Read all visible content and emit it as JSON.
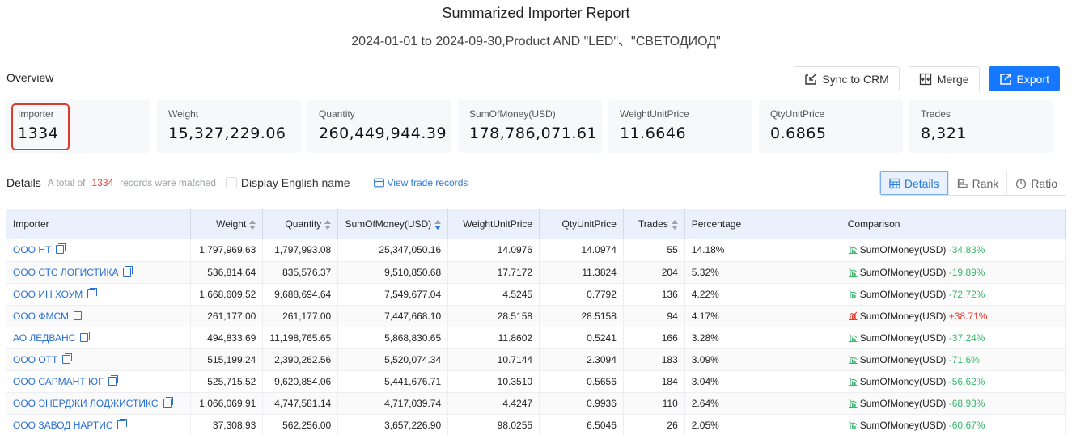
{
  "report": {
    "title": "Summarized Importer Report",
    "subtitle": "2024-01-01 to 2024-09-30,Product AND \"LED\"、\"СВЕТОДИОД\""
  },
  "overview": {
    "label": "Overview",
    "actions": {
      "sync_crm": "Sync to CRM",
      "merge": "Merge",
      "export": "Export"
    },
    "stats": [
      {
        "label": "Importer",
        "value": "1334"
      },
      {
        "label": "Weight",
        "value": "15,327,229.06"
      },
      {
        "label": "Quantity",
        "value": "260,449,944.39"
      },
      {
        "label": "SumOfMoney(USD)",
        "value": "178,786,071.61"
      },
      {
        "label": "WeightUnitPrice",
        "value": "11.6646"
      },
      {
        "label": "QtyUnitPrice",
        "value": "0.6865"
      },
      {
        "label": "Trades",
        "value": "8,321"
      }
    ]
  },
  "details": {
    "title": "Details",
    "total_prefix": "A total of",
    "total_count": "1334",
    "total_suffix": "records were matched",
    "display_english": "Display English name",
    "display_english_checked": false,
    "view_trade_records": "View trade records",
    "views": {
      "details": "Details",
      "rank": "Rank",
      "ratio": "Ratio",
      "active": "details"
    }
  },
  "table": {
    "columns": {
      "importer": "Importer",
      "weight": "Weight",
      "quantity": "Quantity",
      "sum": "SumOfMoney(USD)",
      "wup": "WeightUnitPrice",
      "qup": "QtyUnitPrice",
      "trades": "Trades",
      "percentage": "Percentage",
      "comparison": "Comparison"
    },
    "rows": [
      {
        "importer": "ООО НТ",
        "weight": "1,797,969.63",
        "quantity": "1,797,993.08",
        "sum": "25,347,050.16",
        "wup": "14.0976",
        "qup": "14.0974",
        "trades": "55",
        "percentage": "14.18%",
        "cmp_label": "SumOfMoney(USD)",
        "cmp_value": "-34.83%",
        "cmp_dir": "down"
      },
      {
        "importer": "ООО СТС ЛОГИСТИКА",
        "weight": "536,814.64",
        "quantity": "835,576.37",
        "sum": "9,510,850.68",
        "wup": "17.7172",
        "qup": "11.3824",
        "trades": "204",
        "percentage": "5.32%",
        "cmp_label": "SumOfMoney(USD)",
        "cmp_value": "-19.89%",
        "cmp_dir": "down"
      },
      {
        "importer": "ООО ИН ХОУМ",
        "weight": "1,668,609.52",
        "quantity": "9,688,694.64",
        "sum": "7,549,677.04",
        "wup": "4.5245",
        "qup": "0.7792",
        "trades": "136",
        "percentage": "4.22%",
        "cmp_label": "SumOfMoney(USD)",
        "cmp_value": "-72.72%",
        "cmp_dir": "down"
      },
      {
        "importer": "ООО ФМСМ",
        "weight": "261,177.00",
        "quantity": "261,177.00",
        "sum": "7,447,668.10",
        "wup": "28.5158",
        "qup": "28.5158",
        "trades": "94",
        "percentage": "4.17%",
        "cmp_label": "SumOfMoney(USD)",
        "cmp_value": "+38.71%",
        "cmp_dir": "up"
      },
      {
        "importer": "АО ЛЕДВАНС",
        "weight": "494,833.69",
        "quantity": "11,198,765.65",
        "sum": "5,868,830.65",
        "wup": "11.8602",
        "qup": "0.5241",
        "trades": "166",
        "percentage": "3.28%",
        "cmp_label": "SumOfMoney(USD)",
        "cmp_value": "-37.24%",
        "cmp_dir": "down"
      },
      {
        "importer": "ООО ОТТ",
        "weight": "515,199.24",
        "quantity": "2,390,262.56",
        "sum": "5,520,074.34",
        "wup": "10.7144",
        "qup": "2.3094",
        "trades": "183",
        "percentage": "3.09%",
        "cmp_label": "SumOfMoney(USD)",
        "cmp_value": "-71.6%",
        "cmp_dir": "down"
      },
      {
        "importer": "ООО САРМАНТ ЮГ",
        "weight": "525,715.52",
        "quantity": "9,620,854.06",
        "sum": "5,441,676.71",
        "wup": "10.3510",
        "qup": "0.5656",
        "trades": "184",
        "percentage": "3.04%",
        "cmp_label": "SumOfMoney(USD)",
        "cmp_value": "-56.62%",
        "cmp_dir": "down"
      },
      {
        "importer": "ООО ЭНЕРДЖИ ЛОДЖИСТИКС",
        "weight": "1,066,069.91",
        "quantity": "4,747,581.14",
        "sum": "4,717,039.74",
        "wup": "4.4247",
        "qup": "0.9936",
        "trades": "110",
        "percentage": "2.64%",
        "cmp_label": "SumOfMoney(USD)",
        "cmp_value": "-68.93%",
        "cmp_dir": "down"
      },
      {
        "importer": "ООО ЗАВОД НАРТИС",
        "weight": "37,308.93",
        "quantity": "562,256.00",
        "sum": "3,657,226.90",
        "wup": "98.0255",
        "qup": "6.5046",
        "trades": "26",
        "percentage": "2.05%",
        "cmp_label": "SumOfMoney(USD)",
        "cmp_value": "-60.67%",
        "cmp_dir": "down"
      }
    ]
  },
  "colors": {
    "accent": "#1677ff",
    "link": "#2a6fd6",
    "negative": "#3bb66e",
    "positive": "#e5392a",
    "highlight": "#e03a2a"
  }
}
